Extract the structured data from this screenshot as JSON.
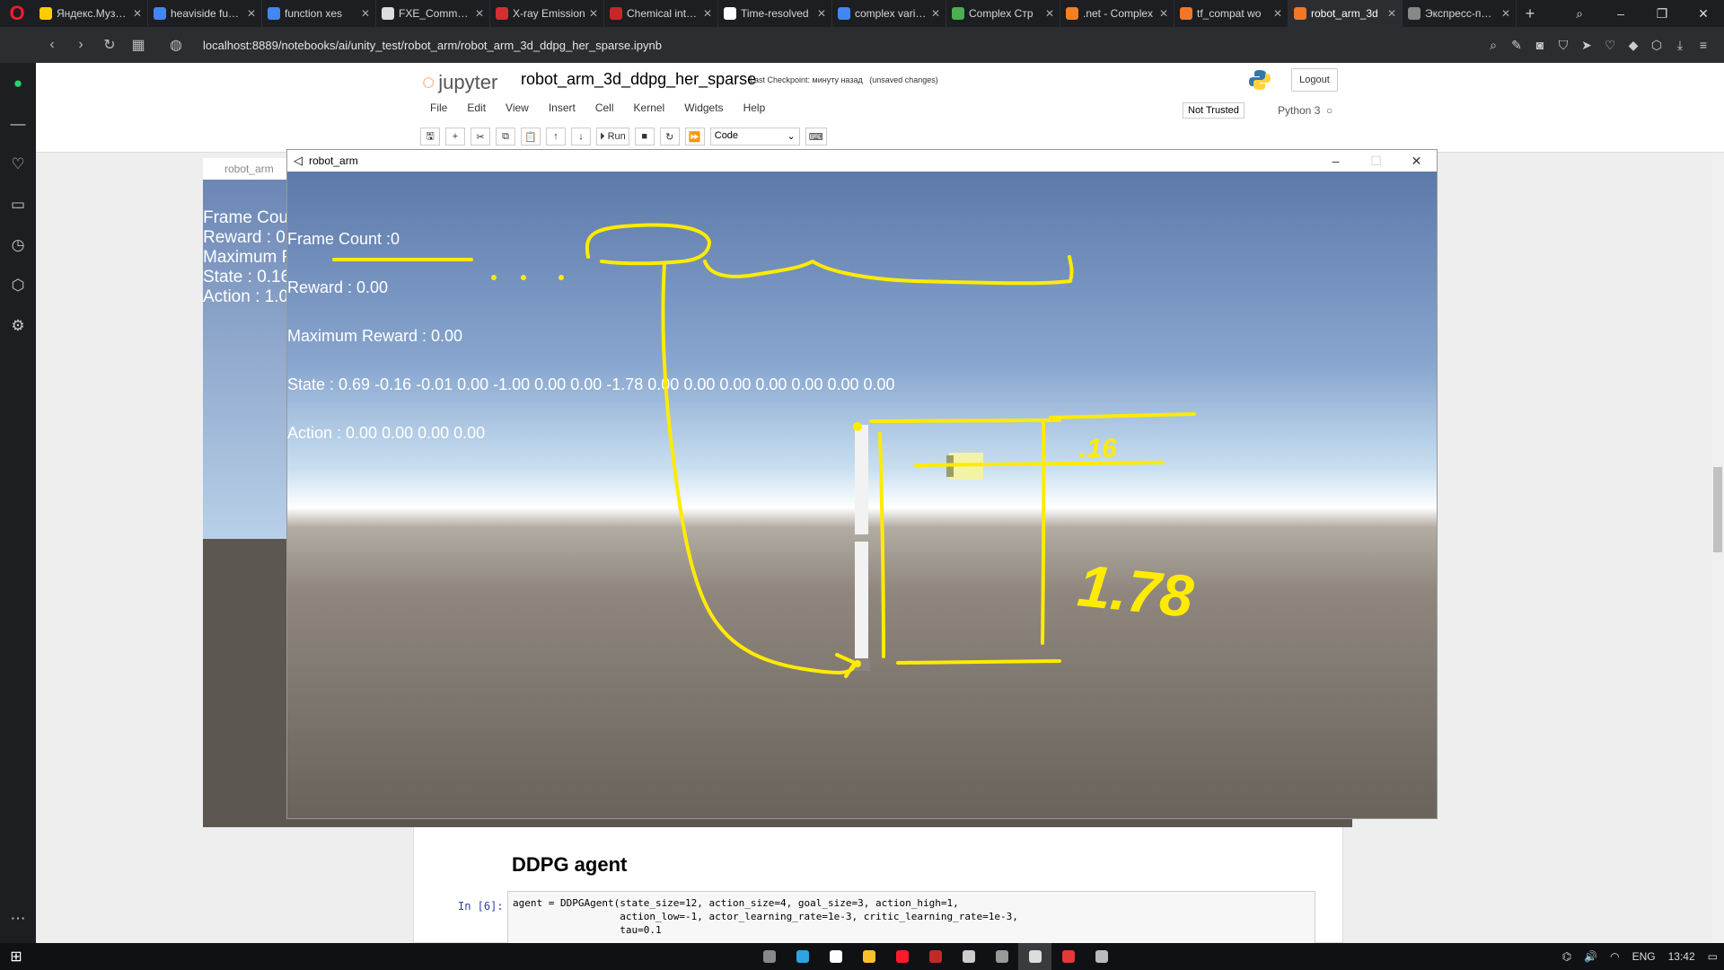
{
  "browser": {
    "tabs": [
      {
        "title": "Яндекс.Музыка",
        "color": "#ffcc00"
      },
      {
        "title": "heaviside function",
        "color": "#4285f4"
      },
      {
        "title": "function xes",
        "color": "#4285f4"
      },
      {
        "title": "FXE_Comm_To",
        "color": "#dddddd"
      },
      {
        "title": "X-ray Emission",
        "color": "#d32f2f"
      },
      {
        "title": "Chemical interactions",
        "color": "#c62828"
      },
      {
        "title": "Time-resolved",
        "color": "#ffffff"
      },
      {
        "title": "complex variable",
        "color": "#4285f4"
      },
      {
        "title": "Complex Стр",
        "color": "#4caf50"
      },
      {
        "title": ".net - Complex",
        "color": "#f48024"
      },
      {
        "title": "tf_compat wo",
        "color": "#f37726"
      },
      {
        "title": "robot_arm_3d",
        "color": "#f37726"
      },
      {
        "title": "Экспресс-панель",
        "color": "#888888"
      }
    ],
    "active_tab": 11,
    "new_tab": "+",
    "url": "localhost:8889/notebooks/ai/unity_test/robot_arm/robot_arm_3d_ddpg_her_sparse.ipynb"
  },
  "jupyter": {
    "logo_text": "jupyter",
    "notebook_name": "robot_arm_3d_ddpg_her_sparse",
    "checkpoint": "Last Checkpoint: минуту назад",
    "unsaved": "(unsaved changes)",
    "logout": "Logout",
    "menus": [
      "File",
      "Edit",
      "View",
      "Insert",
      "Cell",
      "Kernel",
      "Widgets",
      "Help"
    ],
    "trusted": "Not Trusted",
    "kernel": "Python 3",
    "run_label": "Run",
    "cell_type": "Code",
    "section_heading": "DDPG agent",
    "in_prompt": "In [6]:",
    "code_lines": [
      "agent = DDPGAgent(state_size=12, action_size=4, goal_size=3, action_high=1,",
      "                  action_low=-1, actor_learning_rate=1e-3, critic_learning_rate=1e-3,",
      "                  tau=0.1"
    ]
  },
  "bg_window": {
    "title": "robot_arm",
    "lines": [
      "Frame Cou",
      "Reward : 0",
      "Maximum R",
      "State : 0.16",
      "Action : 1.0"
    ]
  },
  "unity_window": {
    "title": "robot_arm",
    "overlay": {
      "frame_count": "Frame Count :0",
      "reward": "Reward : 0.00",
      "max_reward": "Maximum Reward : 0.00",
      "state": "State : 0.69 -0.16 -0.01 0.00 -1.00 0.00 0.00 -1.78 0.00 0.00 0.00 0.00 0.00 0.00 0.00",
      "action": "Action : 0.00 0.00 0.00 0.00"
    },
    "annotations": {
      "value_a": ".16",
      "value_b": "1.78"
    }
  },
  "taskbar": {
    "time": "13:42",
    "lang": "ENG",
    "apps": [
      "#888888",
      "#2ca5e0",
      "#ffffff",
      "#fbc02d",
      "#ff1b2d",
      "#c62828",
      "#cccccc",
      "#999999",
      "#dddddd",
      "#e53935",
      "#bbbbbb"
    ]
  }
}
